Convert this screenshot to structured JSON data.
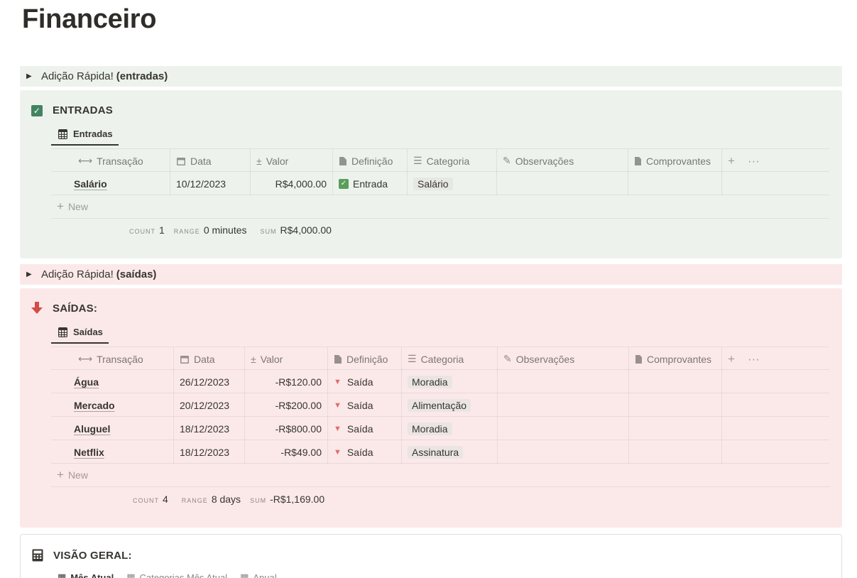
{
  "page": {
    "title": "Financeiro"
  },
  "colors": {
    "green_bg": "#edf3ec",
    "red_bg": "#fbe9e9",
    "check_green": "#448361",
    "arrow_red": "#d44c47"
  },
  "entradas_toggle": {
    "text": "Adição Rápida!",
    "bold": "(entradas)"
  },
  "entradas": {
    "heading": "ENTRADAS",
    "heading_icon": "checkbox-icon",
    "view_tab": "Entradas",
    "columns": [
      "Transação",
      "Data",
      "Valor",
      "Definição",
      "Categoria",
      "Observações",
      "Comprovantes"
    ],
    "rows": [
      {
        "transacao": "Salário",
        "data": "10/12/2023",
        "valor": "R$4,000.00",
        "definicao": "Entrada",
        "categoria": "Salário",
        "observacoes": "",
        "comprovantes": ""
      }
    ],
    "new_label": "New",
    "summary": {
      "count_label": "COUNT",
      "count": "1",
      "range_label": "RANGE",
      "range": "0 minutes",
      "sum_label": "SUM",
      "sum": "R$4,000.00"
    }
  },
  "saidas_toggle": {
    "text": "Adição Rápida!",
    "bold": "(saídas)"
  },
  "saidas": {
    "heading": "SAÍDAS:",
    "heading_icon": "arrow-down-icon",
    "view_tab": "Saídas",
    "columns": [
      "Transação",
      "Data",
      "Valor",
      "Definição",
      "Categoria",
      "Observações",
      "Comprovantes"
    ],
    "rows": [
      {
        "transacao": "Água",
        "data": "26/12/2023",
        "valor": "-R$120.00",
        "definicao": "Saída",
        "categoria": "Moradia"
      },
      {
        "transacao": "Mercado",
        "data": "20/12/2023",
        "valor": "-R$200.00",
        "definicao": "Saída",
        "categoria": "Alimentação"
      },
      {
        "transacao": "Aluguel",
        "data": "18/12/2023",
        "valor": "-R$800.00",
        "definicao": "Saída",
        "categoria": "Moradia"
      },
      {
        "transacao": "Netflix",
        "data": "18/12/2023",
        "valor": "-R$49.00",
        "definicao": "Saída",
        "categoria": "Assinatura"
      }
    ],
    "new_label": "New",
    "summary": {
      "count_label": "COUNT",
      "count": "4",
      "range_label": "RANGE",
      "range": "8 days",
      "sum_label": "SUM",
      "sum": "-R$1,169.00"
    }
  },
  "overview": {
    "heading": "VISÃO GERAL:",
    "tabs": [
      "Mês Atual",
      "Categorias Mês Atual",
      "Anual"
    ]
  }
}
